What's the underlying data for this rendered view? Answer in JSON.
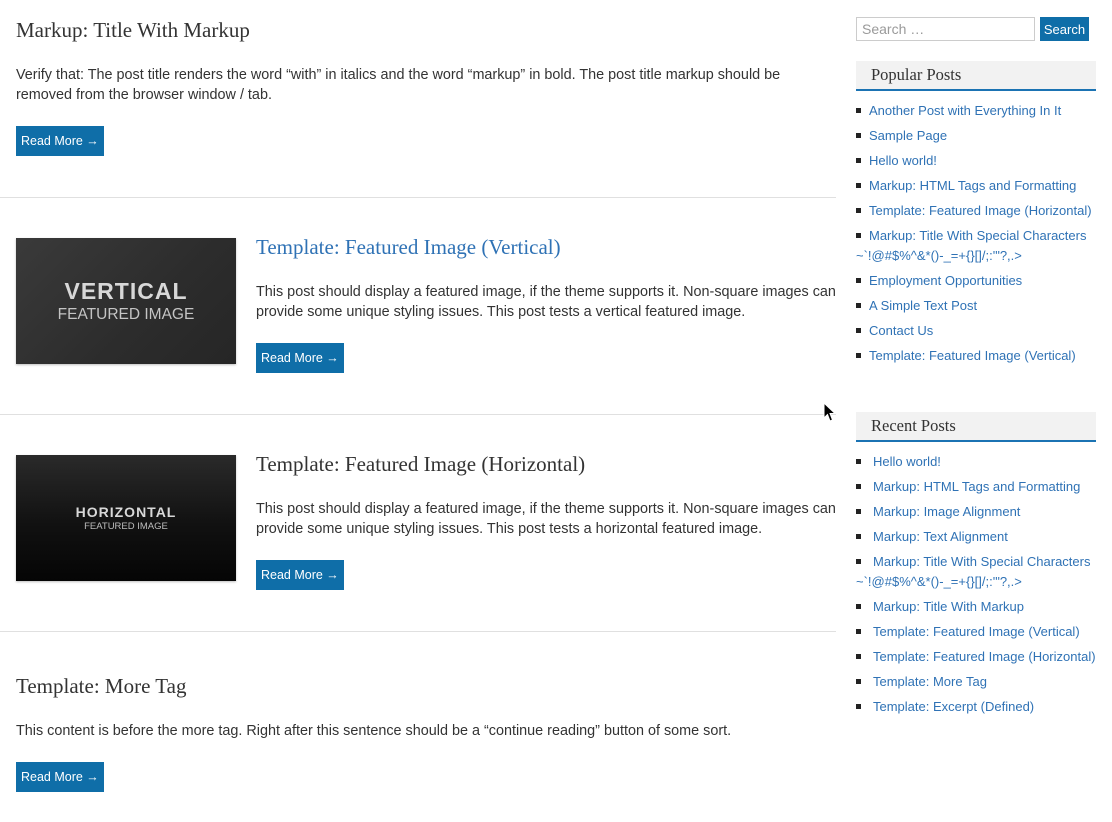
{
  "posts": [
    {
      "title": "Markup: Title With Markup",
      "excerpt": "Verify that: The post title renders the word “with” in italics and the word “markup” in bold. The post title markup should be removed from the browser window / tab.",
      "button": "Read More →"
    },
    {
      "title": "Template: Featured Image (Vertical)",
      "thumb_big": "VERTICAL",
      "thumb_small": "FEATURED IMAGE",
      "excerpt": "This post should display a featured image, if the theme supports it. Non-square images can provide some unique styling issues. This post tests a vertical featured image.",
      "button": "Read More →"
    },
    {
      "title": "Template: Featured Image (Horizontal)",
      "thumb_big": "HORIZONTAL",
      "thumb_small": "FEATURED IMAGE",
      "excerpt": "This post should display a featured image, if the theme supports it. Non-square images can provide some unique styling issues. This post tests a horizontal featured image.",
      "button": "Read More →"
    },
    {
      "title": "Template: More Tag",
      "excerpt": "This content is before the more tag. Right after this sentence should be a “continue reading” button of some sort.",
      "button": "Read More →"
    }
  ],
  "sidebar": {
    "search": {
      "placeholder": "Search …",
      "button": "Search"
    },
    "popular": {
      "title": "Popular Posts",
      "items": [
        "Another Post with Everything In It",
        "Sample Page",
        "Hello world!",
        "Markup: HTML Tags and Formatting",
        "Template: Featured Image (Horizontal)",
        "Markup: Title With Special Characters ~`!@#$%^&*()-_=+{}[]/;:'\"?,.>",
        "Employment Opportunities",
        "A Simple Text Post",
        "Contact Us",
        "Template: Featured Image (Vertical)"
      ]
    },
    "recent": {
      "title": "Recent Posts",
      "items": [
        "Hello world!",
        "Markup: HTML Tags and Formatting",
        "Markup: Image Alignment",
        "Markup: Text Alignment",
        "Markup: Title With Special Characters ~`!@#$%^&*()-_=+{}[]/;:'\"?,.>",
        "Markup: Title With Markup",
        "Template: Featured Image (Vertical)",
        "Template: Featured Image (Horizontal)",
        "Template: More Tag",
        "Template: Excerpt (Defined)"
      ]
    }
  },
  "colors": {
    "accent": "#0f6ea8",
    "link": "#2f72b5",
    "widget_border": "#1b73b3"
  }
}
